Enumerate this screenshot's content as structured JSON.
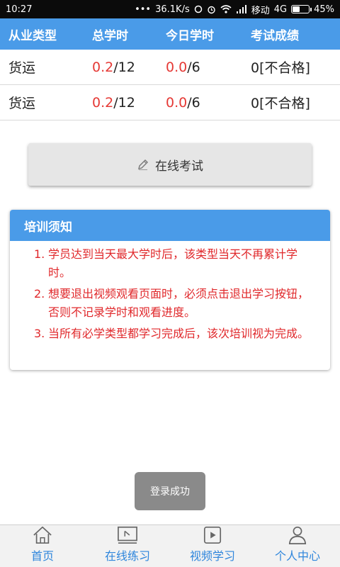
{
  "status_bar": {
    "time": "10:27",
    "dots": "•••",
    "speed": "36.1K/s",
    "carrier": "移动",
    "network": "4G",
    "battery": "45%",
    "battery_level": 0.45
  },
  "table": {
    "headers": [
      "从业类型",
      "总学时",
      "今日学时",
      "考试成绩"
    ],
    "rows": [
      {
        "type": "货运",
        "total_done": "0.2",
        "total_max": "/12",
        "today_done": "0.0",
        "today_max": "/6",
        "score": "0[不合格]"
      },
      {
        "type": "货运",
        "total_done": "0.2",
        "total_max": "/12",
        "today_done": "0.0",
        "today_max": "/6",
        "score": "0[不合格]"
      }
    ]
  },
  "exam_button": {
    "label": "在线考试"
  },
  "notice": {
    "title": "培训须知",
    "items": [
      {
        "num": "1.",
        "text": "学员达到当天最大学时后，该类型当天不再累计学时。"
      },
      {
        "num": "2.",
        "text": "想要退出视频观看页面时，必须点击退出学习按钮，否则不记录学时和观看进度。"
      },
      {
        "num": "3.",
        "text": "当所有必学类型都学习完成后，该次培训视为完成。"
      }
    ]
  },
  "toast": {
    "text": "登录成功"
  },
  "bottom_nav": [
    {
      "label": "首页",
      "icon": "home-icon"
    },
    {
      "label": "在线练习",
      "icon": "practice-icon"
    },
    {
      "label": "视频学习",
      "icon": "video-icon"
    },
    {
      "label": "个人中心",
      "icon": "user-icon"
    }
  ],
  "colors": {
    "accent": "#4a9be8",
    "nav_text": "#2f86dc",
    "alert_red": "#e0282b"
  }
}
